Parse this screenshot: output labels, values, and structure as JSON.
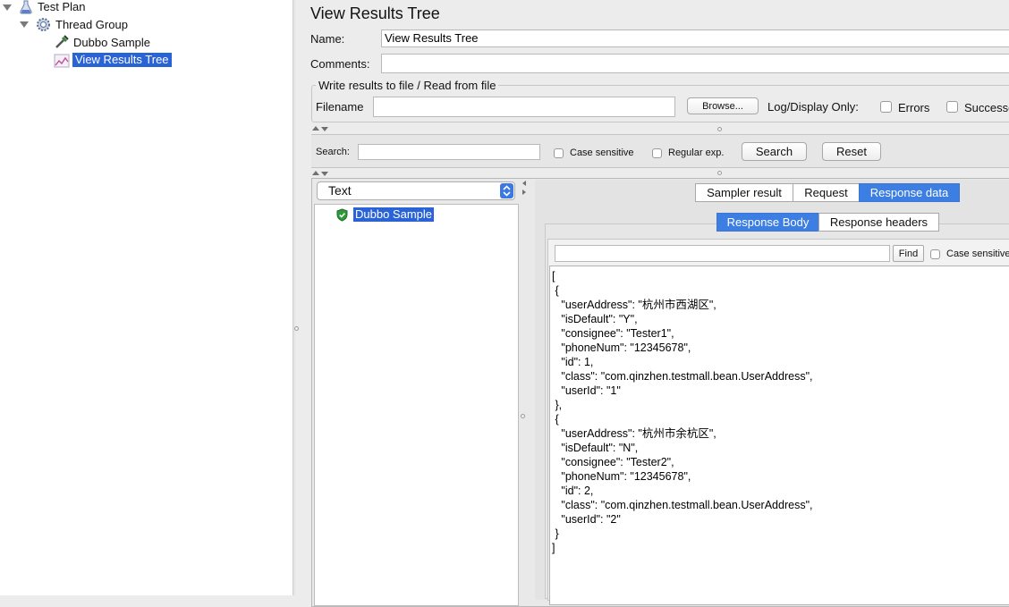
{
  "tree": {
    "nodes": [
      {
        "label": "Test Plan",
        "icon": "flask-icon"
      },
      {
        "label": "Thread Group",
        "icon": "gear-icon"
      },
      {
        "label": "Dubbo Sample",
        "icon": "pipette-icon"
      },
      {
        "label": "View Results Tree",
        "icon": "graph-icon",
        "selected": true
      }
    ]
  },
  "panel": {
    "title": "View Results Tree",
    "name_label": "Name:",
    "name_value": "View Results Tree",
    "comments_label": "Comments:",
    "comments_value": "",
    "file_group_title": "Write results to file / Read from file",
    "filename_label": "Filename",
    "filename_value": "",
    "browse_label": "Browse...",
    "log_display_label": "Log/Display Only:",
    "errors_label": "Errors",
    "success_label": "Successes"
  },
  "search": {
    "label": "Search:",
    "value": "",
    "case_sensitive_label": "Case sensitive",
    "regex_label": "Regular exp.",
    "search_button": "Search",
    "reset_button": "Reset"
  },
  "results": {
    "renderer": "Text",
    "samples": [
      {
        "label": "Dubbo Sample",
        "status": "success"
      }
    ],
    "tabs": [
      {
        "label": "Sampler result",
        "active": false
      },
      {
        "label": "Request",
        "active": false
      },
      {
        "label": "Response data",
        "active": true
      }
    ],
    "subtabs": [
      {
        "label": "Response Body",
        "active": true
      },
      {
        "label": "Response headers",
        "active": false
      }
    ],
    "find_value": "",
    "find_button": "Find",
    "find_case_label": "Case sensitive",
    "response_body": "[\n {\n   \"userAddress\": \"杭州市西湖区\",\n   \"isDefault\": \"Y\",\n   \"consignee\": \"Tester1\",\n   \"phoneNum\": \"12345678\",\n   \"id\": 1,\n   \"class\": \"com.qinzhen.testmall.bean.UserAddress\",\n   \"userId\": \"1\"\n },\n {\n   \"userAddress\": \"杭州市余杭区\",\n   \"isDefault\": \"N\",\n   \"consignee\": \"Tester2\",\n   \"phoneNum\": \"12345678\",\n   \"id\": 2,\n   \"class\": \"com.qinzhen.testmall.bean.UserAddress\",\n   \"userId\": \"2\"\n }\n]"
  },
  "colors": {
    "selection": "#2a63d6",
    "active_tab": "#3d7ee2",
    "success": "#2e9b3a"
  }
}
